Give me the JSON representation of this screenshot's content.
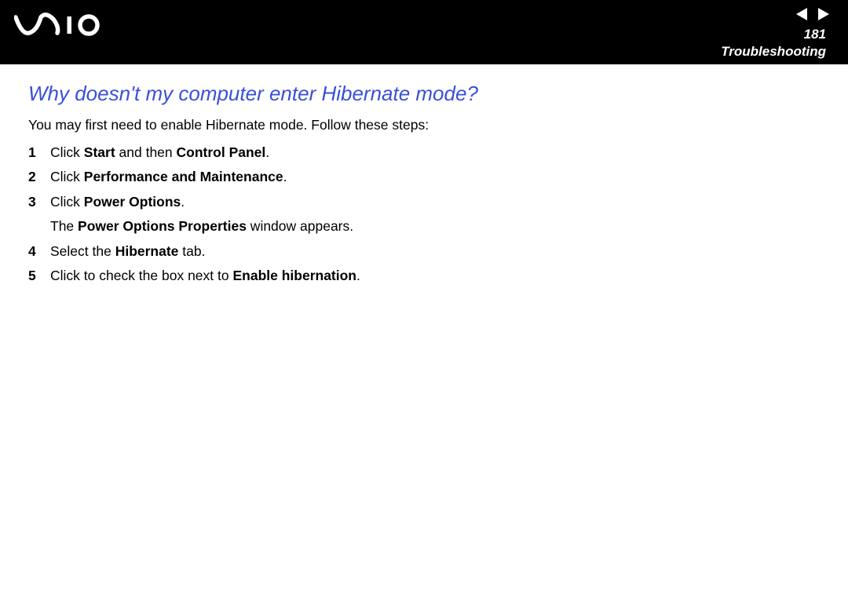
{
  "header": {
    "page_number": "181",
    "section": "Troubleshooting"
  },
  "title": "Why doesn't my computer enter Hibernate mode?",
  "intro": "You may first need to enable Hibernate mode. Follow these steps:",
  "steps": {
    "s1": {
      "num": "1",
      "pre": "Click ",
      "b1": "Start",
      "mid": " and then ",
      "b2": "Control Panel",
      "post": "."
    },
    "s2": {
      "num": "2",
      "pre": "Click ",
      "b1": "Performance and Maintenance",
      "post": "."
    },
    "s3": {
      "num": "3",
      "pre": "Click ",
      "b1": "Power Options",
      "post": "."
    },
    "s3sub": {
      "pre": "The ",
      "b1": "Power Options Properties",
      "post": " window appears."
    },
    "s4": {
      "num": "4",
      "pre": "Select the ",
      "b1": "Hibernate",
      "post": " tab."
    },
    "s5": {
      "num": "5",
      "pre": "Click to check the box next to ",
      "b1": "Enable hibernation",
      "post": "."
    }
  }
}
